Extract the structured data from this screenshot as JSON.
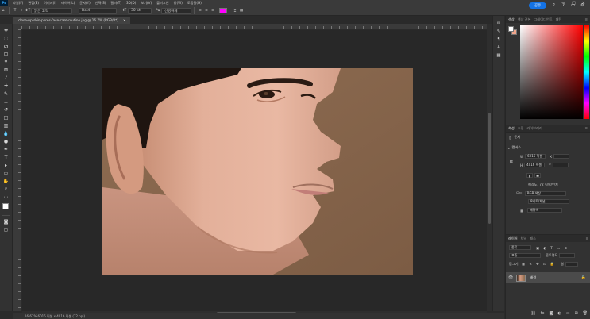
{
  "menubar": {
    "logo": "Ps",
    "items": [
      "파일(F)",
      "편집(E)",
      "이미지(I)",
      "레이어(L)",
      "문자(Y)",
      "선택(S)",
      "필터(T)",
      "3D(D)",
      "보기(V)",
      "플러그인",
      "창(W)",
      "도움말(H)"
    ],
    "window_controls": [
      "—",
      "□",
      "✕"
    ]
  },
  "options": {
    "font_family": "맑은 고딕",
    "font_style": "Bold",
    "font_size": "30 pt",
    "antialias": "선명하게",
    "share_label": "공유"
  },
  "document": {
    "tab_title": "close-up-skin-pores-face-care-routine.jpg @ 16.7% (RGB/8*)",
    "status": "16.67%   6016 픽셀 x 4016 픽셀 (72 ppi)"
  },
  "colors": {
    "foreground": "#ffffff",
    "background": "#f0a48a"
  },
  "color_panel": {
    "tabs": [
      "색상",
      "색상 견본",
      "그레이디언트",
      "패턴"
    ]
  },
  "properties": {
    "tabs": [
      "속성",
      "조정",
      "라이브러리"
    ],
    "doc_label": "문서",
    "section": "캔버스",
    "width_label": "W",
    "width_value": "6016 픽셀",
    "height_label": "H",
    "height_value": "4016 픽셀",
    "x_label": "X",
    "y_label": "Y",
    "resolution": "해상도: 72 픽셀/인치",
    "mode_label": "모드",
    "mode_value": "RGB 색상",
    "depth_value": "8비트/채널",
    "fill_value": "배경색"
  },
  "layers": {
    "tabs": [
      "레이어",
      "채널",
      "패스"
    ],
    "kind_label": "종류",
    "blend_mode": "표준",
    "opacity_label": "불투명도",
    "lock_label": "잠그기:",
    "fill_label": "칠",
    "layer_name": "배경"
  }
}
